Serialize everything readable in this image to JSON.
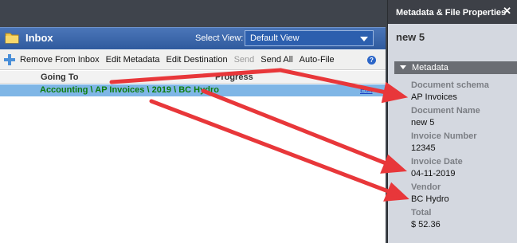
{
  "inbox": {
    "title": "Inbox",
    "select_view_label": "Select View:",
    "select_view_value": "Default View"
  },
  "toolbar": {
    "remove_from_inbox": "Remove From Inbox",
    "edit_metadata": "Edit Metadata",
    "edit_destination": "Edit Destination",
    "send": "Send",
    "send_all": "Send All",
    "auto_file": "Auto-File",
    "help": "?"
  },
  "grid": {
    "columns": {
      "going_to": "Going To",
      "progress": "Progress"
    },
    "rows": [
      {
        "destination": "Accounting \\ AP Invoices \\ 2019 \\ BC Hydro",
        "action": "Edit"
      }
    ]
  },
  "properties": {
    "title": "Metadata & File Properties",
    "document_name": "new 5",
    "section": "Metadata",
    "fields": [
      {
        "label": "Document schema",
        "value": "AP Invoices"
      },
      {
        "label": "Document Name",
        "value": "new 5"
      },
      {
        "label": "Invoice Number",
        "value": "12345"
      },
      {
        "label": "Invoice Date",
        "value": "04-11-2019"
      },
      {
        "label": "Vendor",
        "value": "BC Hydro"
      },
      {
        "label": "Total",
        "value": "$ 52.36"
      }
    ]
  },
  "colors": {
    "title_bar": "#2f5a9e",
    "selected_row": "#7fb6e6",
    "destination_text": "#0d7d0d",
    "annotation_arrow": "#e8373a"
  },
  "icons": [
    "folder-icon",
    "add-icon",
    "help-icon",
    "dropdown-icon",
    "close-icon",
    "collapse-icon"
  ]
}
